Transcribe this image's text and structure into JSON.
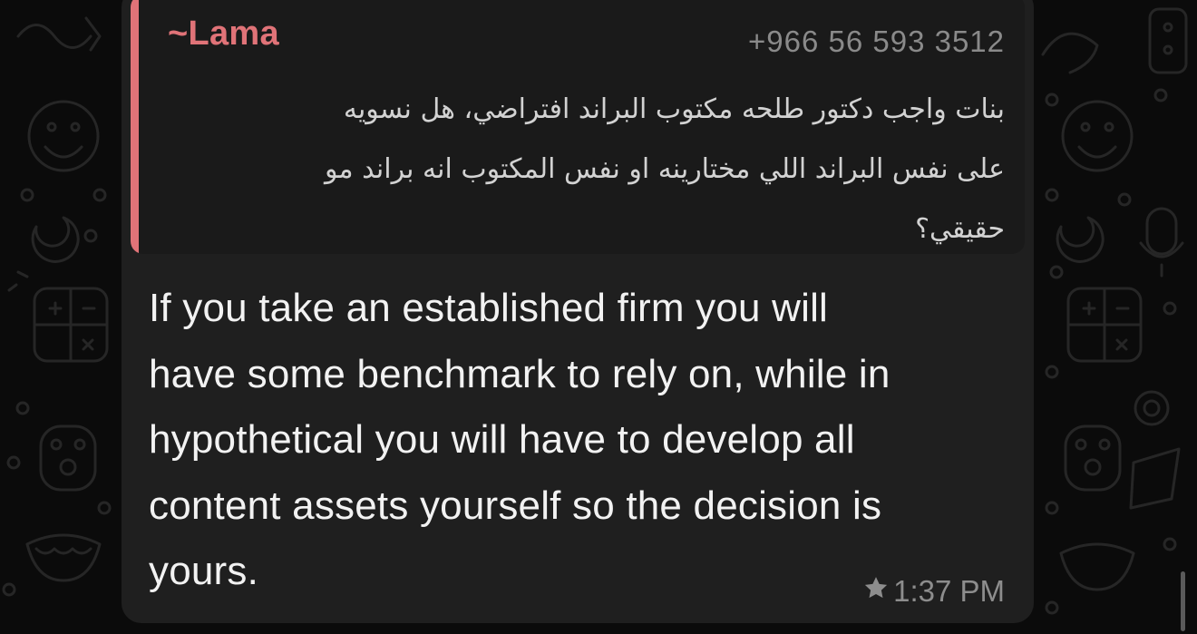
{
  "message": {
    "quote": {
      "author": "~Lama",
      "phone": "+966 56 593 3512",
      "lines": [
        "بنات واجب دكتور طلحه مكتوب البراند افتراضي، هل نسويه",
        "على نفس البراند اللي مختارينه او نفس المكتوب انه براند مو",
        "حقيقي؟"
      ]
    },
    "text_lines": [
      "If you take an established firm you will",
      "have some benchmark to rely on, while in",
      "hypothetical you will have to develop all",
      "content assets yourself so the decision is",
      "yours."
    ],
    "time": "1:37 PM",
    "starred_icon": "star-icon"
  },
  "colors": {
    "quote_accent": "#e07378",
    "bubble": "#1f1f1f",
    "quote_bg": "#1a1a1a",
    "background": "#0b0b0b"
  }
}
